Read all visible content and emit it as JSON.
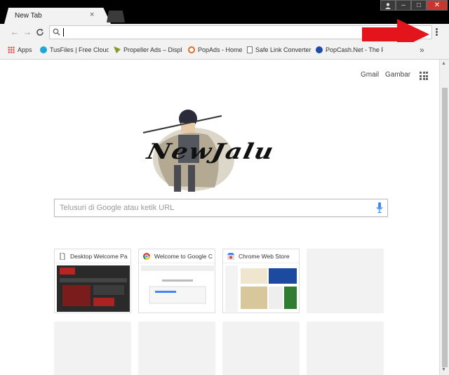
{
  "tab": {
    "title": "New Tab",
    "close_glyph": "×"
  },
  "window": {
    "minimize": "–",
    "maximize": "□",
    "close": "✕"
  },
  "toolbar": {
    "back_glyph": "←",
    "forward_glyph": "→",
    "reload_glyph": "C",
    "address_value": ""
  },
  "bookmarks": {
    "items": [
      {
        "label": "Apps",
        "icon": "apps-grid-icon"
      },
      {
        "label": "TusFiles | Free Cloud S",
        "icon": "tusfiles-icon"
      },
      {
        "label": "Propeller Ads – Displa",
        "icon": "propeller-icon"
      },
      {
        "label": "PopAds - Home",
        "icon": "popads-icon"
      },
      {
        "label": "Safe Link Converter",
        "icon": "page-icon"
      },
      {
        "label": "PopCash.Net - The Po",
        "icon": "popcash-icon"
      }
    ],
    "more_glyph": "»"
  },
  "newtab": {
    "links": {
      "gmail": "Gmail",
      "images": "Gambar"
    },
    "doodle_text": "NewJalu",
    "search_placeholder": "Telusuri di Google atau ketik URL",
    "tiles": [
      {
        "title": "Desktop Welcome Pa",
        "icon": "page-icon"
      },
      {
        "title": "Welcome to Google C",
        "icon": "chrome-icon"
      },
      {
        "title": "Chrome Web Store",
        "icon": "webstore-icon"
      }
    ]
  },
  "annotation": {
    "arrow_color": "#e3141b"
  }
}
